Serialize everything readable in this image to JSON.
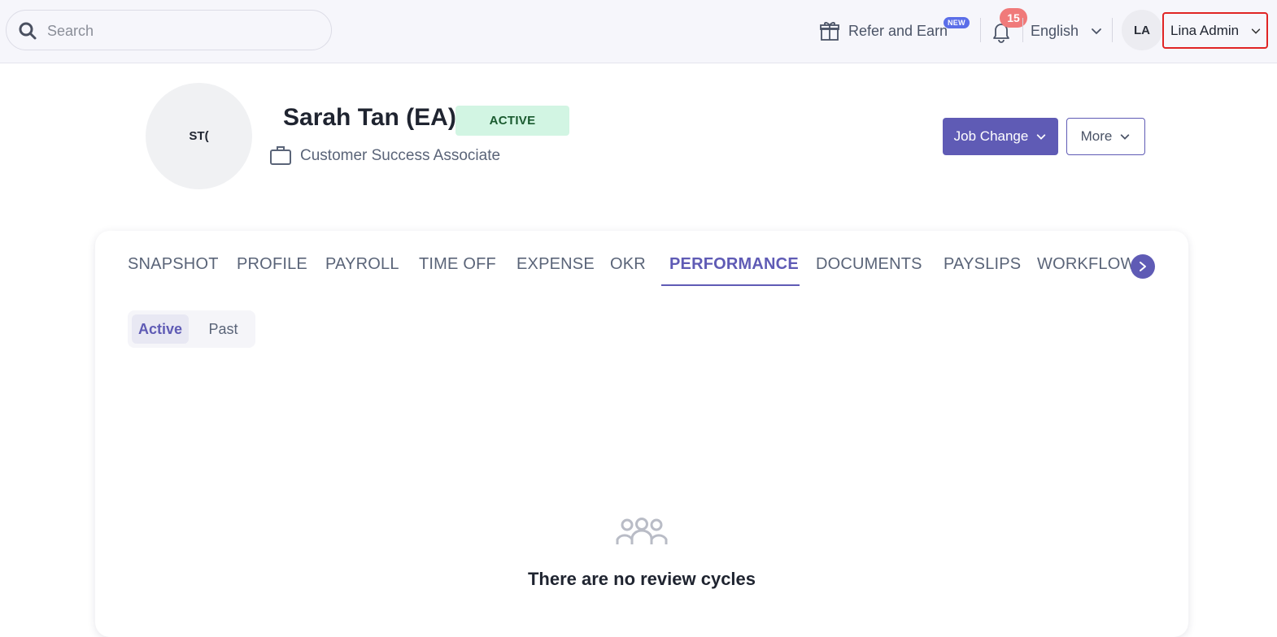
{
  "topbar": {
    "search": {
      "placeholder": "Search",
      "value": ""
    },
    "refer": {
      "label": "Refer and Earn",
      "badge": "NEW"
    },
    "notifications": {
      "count": "15"
    },
    "language": {
      "selected": "English"
    },
    "user": {
      "initials": "LA",
      "name": "Lina Admin"
    }
  },
  "employee": {
    "avatar_initials": "ST(",
    "name": "Sarah Tan (EA)",
    "status": "ACTIVE",
    "job_title": "Customer Success Associate"
  },
  "actions": {
    "job_change_label": "Job Change",
    "more_label": "More"
  },
  "tabs": [
    {
      "label": "SNAPSHOT",
      "active": false
    },
    {
      "label": "PROFILE",
      "active": false
    },
    {
      "label": "PAYROLL",
      "active": false
    },
    {
      "label": "TIME OFF",
      "active": false
    },
    {
      "label": "EXPENSE",
      "active": false
    },
    {
      "label": "OKR",
      "active": false
    },
    {
      "label": "PERFORMANCE",
      "active": true
    },
    {
      "label": "DOCUMENTS",
      "active": false
    },
    {
      "label": "PAYSLIPS",
      "active": false
    },
    {
      "label": "WORKFLOWS",
      "active": false
    }
  ],
  "segments": {
    "active_label": "Active",
    "past_label": "Past"
  },
  "empty_state": {
    "icon": "users-group-icon",
    "message": "There are no review cycles"
  },
  "colors": {
    "primary": "#5f5bb5",
    "status_bg": "#d2f5e3",
    "notification_badge": "#f07a7a",
    "new_badge": "#5b6ee8",
    "highlight_border": "#e02424"
  }
}
